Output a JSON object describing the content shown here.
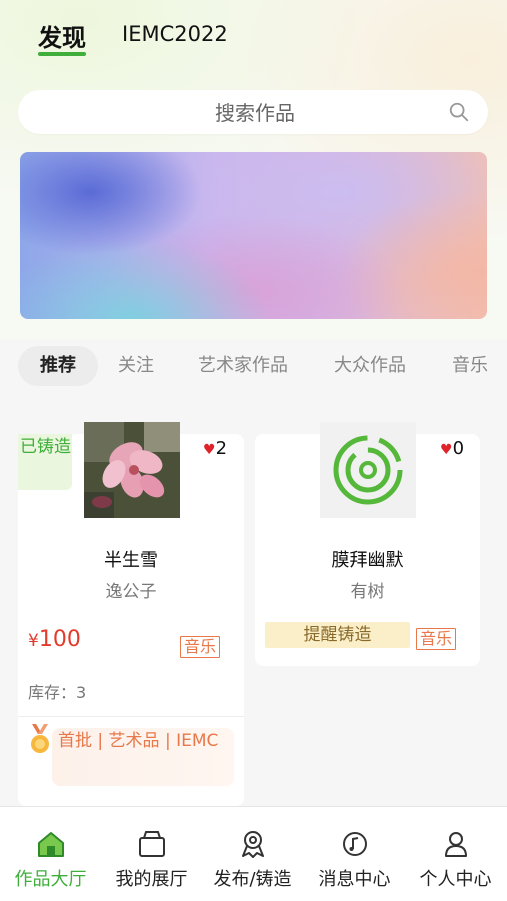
{
  "header": {
    "tabs": [
      {
        "label": "发现",
        "active": true
      },
      {
        "label": "IEMC2022",
        "active": false
      }
    ]
  },
  "search": {
    "placeholder": "搜索作品",
    "icon": "search-icon"
  },
  "categories": [
    {
      "label": "推荐",
      "active": true
    },
    {
      "label": "关注"
    },
    {
      "label": "艺术家作品"
    },
    {
      "label": "大众作品"
    },
    {
      "label": "音乐"
    }
  ],
  "works": [
    {
      "status": "已铸造",
      "likes": "2",
      "title": "半生雪",
      "artist": "逸公子",
      "price_symbol": "¥",
      "price": "100",
      "tag": "音乐",
      "stock_label": "库存：",
      "stock": "3",
      "badge": "首批 | 艺术品 | IEMC"
    },
    {
      "likes": "0",
      "title": "膜拜幽默",
      "artist": "有树",
      "remind": "提醒铸造",
      "tag": "音乐"
    }
  ],
  "bottom_nav": [
    {
      "label": "作品大厅",
      "icon": "hall-icon",
      "active": true
    },
    {
      "label": "我的展厅",
      "icon": "gallery-icon"
    },
    {
      "label": "发布/铸造",
      "icon": "publish-icon"
    },
    {
      "label": "消息中心",
      "icon": "message-icon"
    },
    {
      "label": "个人中心",
      "icon": "profile-icon"
    }
  ],
  "colors": {
    "accent": "#3fae3b",
    "price": "#e23b2c",
    "tag": "#e8784a"
  }
}
